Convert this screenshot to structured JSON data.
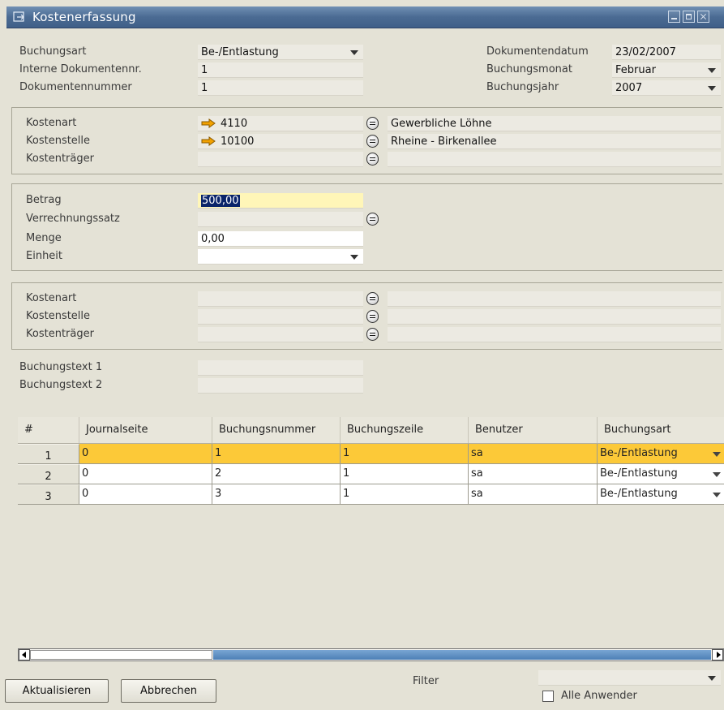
{
  "window": {
    "title": "Kostenerfassung"
  },
  "header": {
    "buchungsart": {
      "label": "Buchungsart",
      "value": "Be-/Entlastung"
    },
    "interne_nr": {
      "label": "Interne Dokumentennr.",
      "value": "1"
    },
    "dok_nr": {
      "label": "Dokumentennummer",
      "value": "1"
    },
    "dok_datum": {
      "label": "Dokumentendatum",
      "value": "23/02/2007"
    },
    "buchungsmonat": {
      "label": "Buchungsmonat",
      "value": "Februar"
    },
    "buchungsjahr": {
      "label": "Buchungsjahr",
      "value": "2007"
    }
  },
  "section1": {
    "kostenart": {
      "label": "Kostenart",
      "value": "4110",
      "desc": "Gewerbliche Löhne"
    },
    "kostenstelle": {
      "label": "Kostenstelle",
      "value": "10100",
      "desc": "Rheine - Birkenallee"
    },
    "kostentraeger": {
      "label": "Kostenträger",
      "value": "",
      "desc": ""
    }
  },
  "section2": {
    "betrag": {
      "label": "Betrag",
      "value": "500,00"
    },
    "verrechnungssatz": {
      "label": "Verrechnungssatz",
      "value": ""
    },
    "menge": {
      "label": "Menge",
      "value": "0,00"
    },
    "einheit": {
      "label": "Einheit",
      "value": ""
    }
  },
  "section3": {
    "kostenart": {
      "label": "Kostenart"
    },
    "kostenstelle": {
      "label": "Kostenstelle"
    },
    "kostentraeger": {
      "label": "Kostenträger"
    }
  },
  "texts": {
    "text1": {
      "label": "Buchungstext 1",
      "value": ""
    },
    "text2": {
      "label": "Buchungstext 2",
      "value": ""
    }
  },
  "grid": {
    "columns": [
      "#",
      "Journalseite",
      "Buchungsnummer",
      "Buchungszeile",
      "Benutzer",
      "Buchungsart"
    ],
    "rows": [
      {
        "num": "1",
        "journalseite": "0",
        "buchungsnummer": "1",
        "buchungszeile": "1",
        "benutzer": "sa",
        "buchungsart": "Be-/Entlastung"
      },
      {
        "num": "2",
        "journalseite": "0",
        "buchungsnummer": "2",
        "buchungszeile": "1",
        "benutzer": "sa",
        "buchungsart": "Be-/Entlastung"
      },
      {
        "num": "3",
        "journalseite": "0",
        "buchungsnummer": "3",
        "buchungszeile": "1",
        "benutzer": "sa",
        "buchungsart": "Be-/Entlastung"
      }
    ]
  },
  "footer": {
    "aktualisieren": "Aktualisieren",
    "abbrechen": "Abbrechen",
    "filter_label": "Filter",
    "filter_value": "",
    "alle_anwender": "Alle Anwender"
  },
  "colors": {
    "title_bar": "#4b6b93",
    "active_row": "#fcc938",
    "input_highlight": "#fff6b8",
    "link_arrow": "#f2a100"
  }
}
